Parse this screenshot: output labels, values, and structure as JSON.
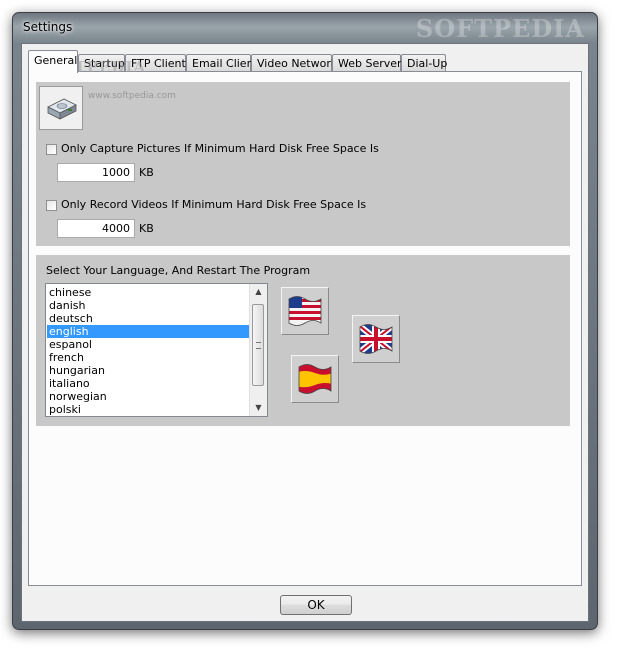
{
  "window": {
    "title": "Settings",
    "watermark": "SOFTPEDIA"
  },
  "tabs": [
    {
      "label": "General",
      "active": true
    },
    {
      "label": "Startup"
    },
    {
      "label": "FTP Client"
    },
    {
      "label": "Email Client"
    },
    {
      "label": "Video Network"
    },
    {
      "label": "Web Server"
    },
    {
      "label": "Dial-Up"
    }
  ],
  "general": {
    "logo_text": "SOFTPEDIA",
    "small_text": "www.softpedia.com",
    "capture_label": "Only Capture Pictures If Minimum Hard Disk Free Space Is",
    "capture_checked": false,
    "capture_value": "1000",
    "capture_unit": "KB",
    "record_label": "Only Record Videos If Minimum Hard Disk Free Space Is",
    "record_checked": false,
    "record_value": "4000",
    "record_unit": "KB"
  },
  "language": {
    "heading": "Select Your Language, And Restart The Program",
    "items": [
      "chinese",
      "danish",
      "deutsch",
      "english",
      "espanol",
      "french",
      "hungarian",
      "italiano",
      "norwegian",
      "polski"
    ],
    "selected": "english",
    "flags": [
      "us-flag-icon",
      "uk-flag-icon",
      "spain-flag-icon"
    ]
  },
  "buttons": {
    "ok": "OK"
  },
  "colors": {
    "selection": "#3399ff",
    "panel": "#c8c8c8"
  }
}
